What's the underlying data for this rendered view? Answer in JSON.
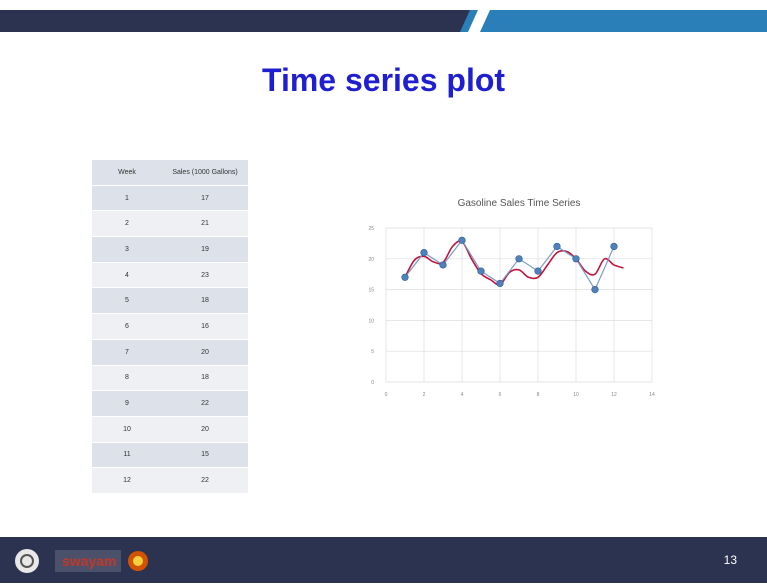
{
  "slide": {
    "title": "Time series plot",
    "page_number": "13",
    "logo_text": "swayam",
    "colors": {
      "title": "#1f1fd1",
      "bar": "#2c3350",
      "accent": "#2a7fb8"
    }
  },
  "table": {
    "headers": [
      "Week",
      "Sales (1000 Gallons)"
    ],
    "rows": [
      [
        "1",
        "17"
      ],
      [
        "2",
        "21"
      ],
      [
        "3",
        "19"
      ],
      [
        "4",
        "23"
      ],
      [
        "5",
        "18"
      ],
      [
        "6",
        "16"
      ],
      [
        "7",
        "20"
      ],
      [
        "8",
        "18"
      ],
      [
        "9",
        "22"
      ],
      [
        "10",
        "20"
      ],
      [
        "11",
        "15"
      ],
      [
        "12",
        "22"
      ]
    ]
  },
  "chart_data": {
    "type": "line",
    "title": "Gasoline Sales Time Series",
    "xlabel": "",
    "ylabel": "",
    "xlim": [
      0,
      14
    ],
    "ylim": [
      0,
      25
    ],
    "xticks": [
      0,
      2,
      4,
      6,
      8,
      10,
      12,
      14
    ],
    "yticks": [
      0,
      5,
      10,
      15,
      20,
      25
    ],
    "grid": true,
    "series": [
      {
        "values_x": [
          1,
          2,
          3,
          4,
          5,
          6,
          7,
          8,
          9,
          10,
          11,
          12
        ],
        "values": [
          17,
          21,
          19,
          23,
          18,
          16,
          20,
          18,
          22,
          20,
          15,
          22
        ],
        "style": "line+markers",
        "color": "#4f81bd"
      },
      {
        "values_x": [
          1,
          1.5,
          2,
          2.5,
          3,
          3.5,
          4,
          4.5,
          5,
          5.5,
          6,
          6.5,
          7,
          7.5,
          8,
          8.5,
          9,
          9.5,
          10,
          10.5,
          11,
          11.5,
          12,
          12.5
        ],
        "values": [
          17,
          19.8,
          20.4,
          19.5,
          19.4,
          22,
          22.8,
          20,
          17.6,
          16.6,
          15.8,
          17.8,
          18.2,
          17,
          17,
          19,
          21,
          21.2,
          20,
          18,
          17.5,
          20,
          19,
          18.5
        ],
        "style": "smooth",
        "color": "#c0143c"
      }
    ]
  }
}
